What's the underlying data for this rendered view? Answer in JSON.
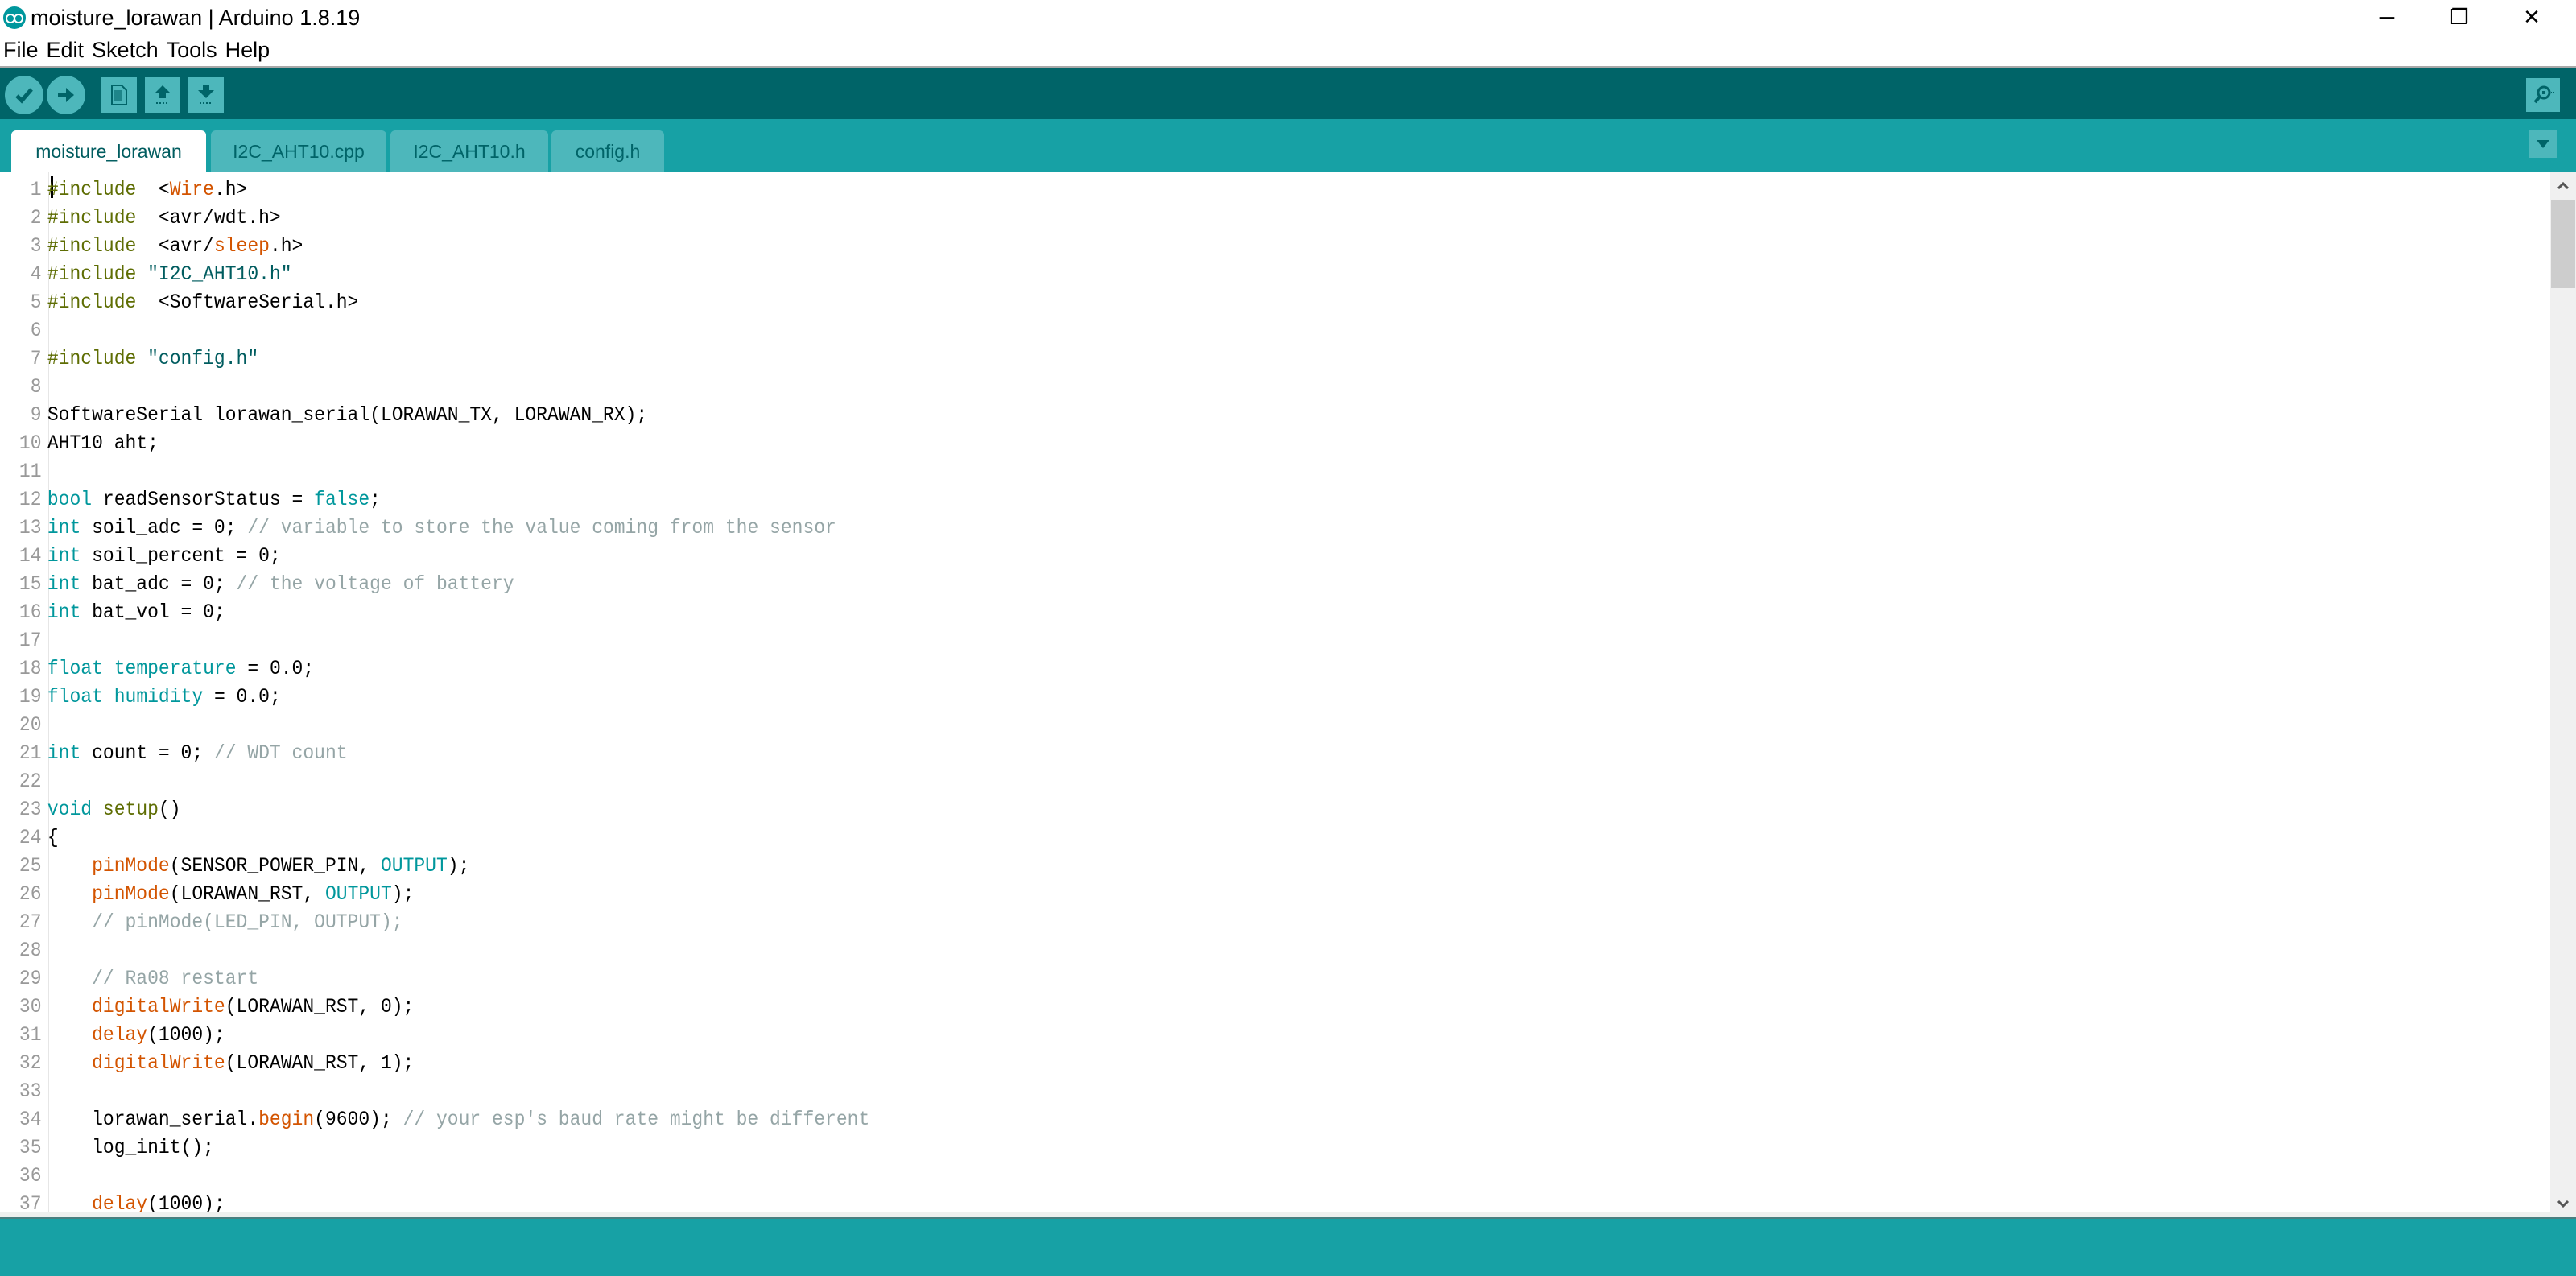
{
  "window": {
    "title": "moisture_lorawan | Arduino 1.8.19",
    "app_icon": "arduino-logo-icon",
    "controls": {
      "minimize": "─",
      "restore": "❐",
      "close": "✕"
    }
  },
  "menubar": {
    "items": [
      "File",
      "Edit",
      "Sketch",
      "Tools",
      "Help"
    ]
  },
  "toolbar": {
    "buttons": [
      {
        "name": "verify",
        "icon": "checkmark-icon",
        "glyph": "✔"
      },
      {
        "name": "upload",
        "icon": "arrow-right-icon",
        "glyph": "➔"
      },
      {
        "name": "new",
        "icon": "new-file-icon",
        "glyph": "▦"
      },
      {
        "name": "open",
        "icon": "arrow-up-icon",
        "glyph": "🡅"
      },
      {
        "name": "save",
        "icon": "arrow-down-icon",
        "glyph": "🡇"
      }
    ],
    "serial_monitor": {
      "icon": "magnifier-icon",
      "glyph": "⚲"
    }
  },
  "tabs": [
    {
      "label": "moisture_lorawan",
      "active": true
    },
    {
      "label": "I2C_AHT10.cpp",
      "active": false
    },
    {
      "label": "I2C_AHT10.h",
      "active": false
    },
    {
      "label": "config.h",
      "active": false
    }
  ],
  "tab_menu": {
    "icon": "triangle-down-icon",
    "glyph": "▼"
  },
  "editor": {
    "lines": [
      [
        [
          "pre",
          "#include"
        ],
        [
          "",
          "  <"
        ],
        [
          "fn",
          "Wire"
        ],
        [
          "",
          ".h>"
        ]
      ],
      [
        [
          "pre",
          "#include"
        ],
        [
          "",
          "  <avr/wdt.h>"
        ]
      ],
      [
        [
          "pre",
          "#include"
        ],
        [
          "",
          "  <avr/"
        ],
        [
          "fn",
          "sleep"
        ],
        [
          "",
          ".h>"
        ]
      ],
      [
        [
          "pre",
          "#include"
        ],
        [
          "str",
          " \"I2C_AHT10.h\""
        ]
      ],
      [
        [
          "pre",
          "#include"
        ],
        [
          "",
          "  <SoftwareSerial.h>"
        ]
      ],
      [],
      [
        [
          "pre",
          "#include"
        ],
        [
          "str",
          " \"config.h\""
        ]
      ],
      [],
      [
        [
          "",
          "SoftwareSerial lorawan_serial(LORAWAN_TX, LORAWAN_RX);"
        ]
      ],
      [
        [
          "",
          "AHT10 aht;"
        ]
      ],
      [],
      [
        [
          "kw",
          "bool"
        ],
        [
          "",
          " readSensorStatus = "
        ],
        [
          "kw",
          "false"
        ],
        [
          "",
          ";"
        ]
      ],
      [
        [
          "kw",
          "int"
        ],
        [
          "",
          " soil_adc = 0; "
        ],
        [
          "com",
          "// variable to store the value coming from the sensor"
        ]
      ],
      [
        [
          "kw",
          "int"
        ],
        [
          "",
          " soil_percent = 0;"
        ]
      ],
      [
        [
          "kw",
          "int"
        ],
        [
          "",
          " bat_adc = 0; "
        ],
        [
          "com",
          "// the voltage of battery"
        ]
      ],
      [
        [
          "kw",
          "int"
        ],
        [
          "",
          " bat_vol = 0;"
        ]
      ],
      [],
      [
        [
          "kw",
          "float"
        ],
        [
          "",
          " "
        ],
        [
          "kw",
          "temperature"
        ],
        [
          "",
          " = 0.0;"
        ]
      ],
      [
        [
          "kw",
          "float"
        ],
        [
          "",
          " "
        ],
        [
          "kw",
          "humidity"
        ],
        [
          "",
          " = 0.0;"
        ]
      ],
      [],
      [
        [
          "kw",
          "int"
        ],
        [
          "",
          " count = 0; "
        ],
        [
          "com",
          "// WDT count"
        ]
      ],
      [],
      [
        [
          "kw",
          "void"
        ],
        [
          "",
          " "
        ],
        [
          "pre",
          "setup"
        ],
        [
          "",
          "()"
        ]
      ],
      [
        [
          "",
          "{"
        ]
      ],
      [
        [
          "",
          "    "
        ],
        [
          "fn",
          "pinMode"
        ],
        [
          "",
          "(SENSOR_POWER_PIN, "
        ],
        [
          "kw",
          "OUTPUT"
        ],
        [
          "",
          ");"
        ]
      ],
      [
        [
          "",
          "    "
        ],
        [
          "fn",
          "pinMode"
        ],
        [
          "",
          "(LORAWAN_RST, "
        ],
        [
          "kw",
          "OUTPUT"
        ],
        [
          "",
          ");"
        ]
      ],
      [
        [
          "",
          "    "
        ],
        [
          "com",
          "// pinMode(LED_PIN, OUTPUT);"
        ]
      ],
      [],
      [
        [
          "",
          "    "
        ],
        [
          "com",
          "// Ra08 restart"
        ]
      ],
      [
        [
          "",
          "    "
        ],
        [
          "fn",
          "digitalWrite"
        ],
        [
          "",
          "(LORAWAN_RST, 0);"
        ]
      ],
      [
        [
          "",
          "    "
        ],
        [
          "fn",
          "delay"
        ],
        [
          "",
          "(1000);"
        ]
      ],
      [
        [
          "",
          "    "
        ],
        [
          "fn",
          "digitalWrite"
        ],
        [
          "",
          "(LORAWAN_RST, 1);"
        ]
      ],
      [],
      [
        [
          "",
          "    lorawan_serial."
        ],
        [
          "fn",
          "begin"
        ],
        [
          "",
          "(9600); "
        ],
        [
          "com",
          "// your esp's baud rate might be different"
        ]
      ],
      [
        [
          "",
          "    log_init();"
        ]
      ],
      [],
      [
        [
          "",
          "    "
        ],
        [
          "fn",
          "delay"
        ],
        [
          "",
          "(1000);"
        ]
      ]
    ]
  },
  "scrollbar": {
    "up": "⌃",
    "down": "⌄",
    "position_fraction": 0.0
  },
  "colors": {
    "toolbar": "#006468",
    "tabbar": "#17a1a5",
    "button": "#4db7bb",
    "keyword": "#00979c",
    "function": "#d35400",
    "preprocessor": "#5e6d03",
    "comment": "#95a5a6"
  }
}
